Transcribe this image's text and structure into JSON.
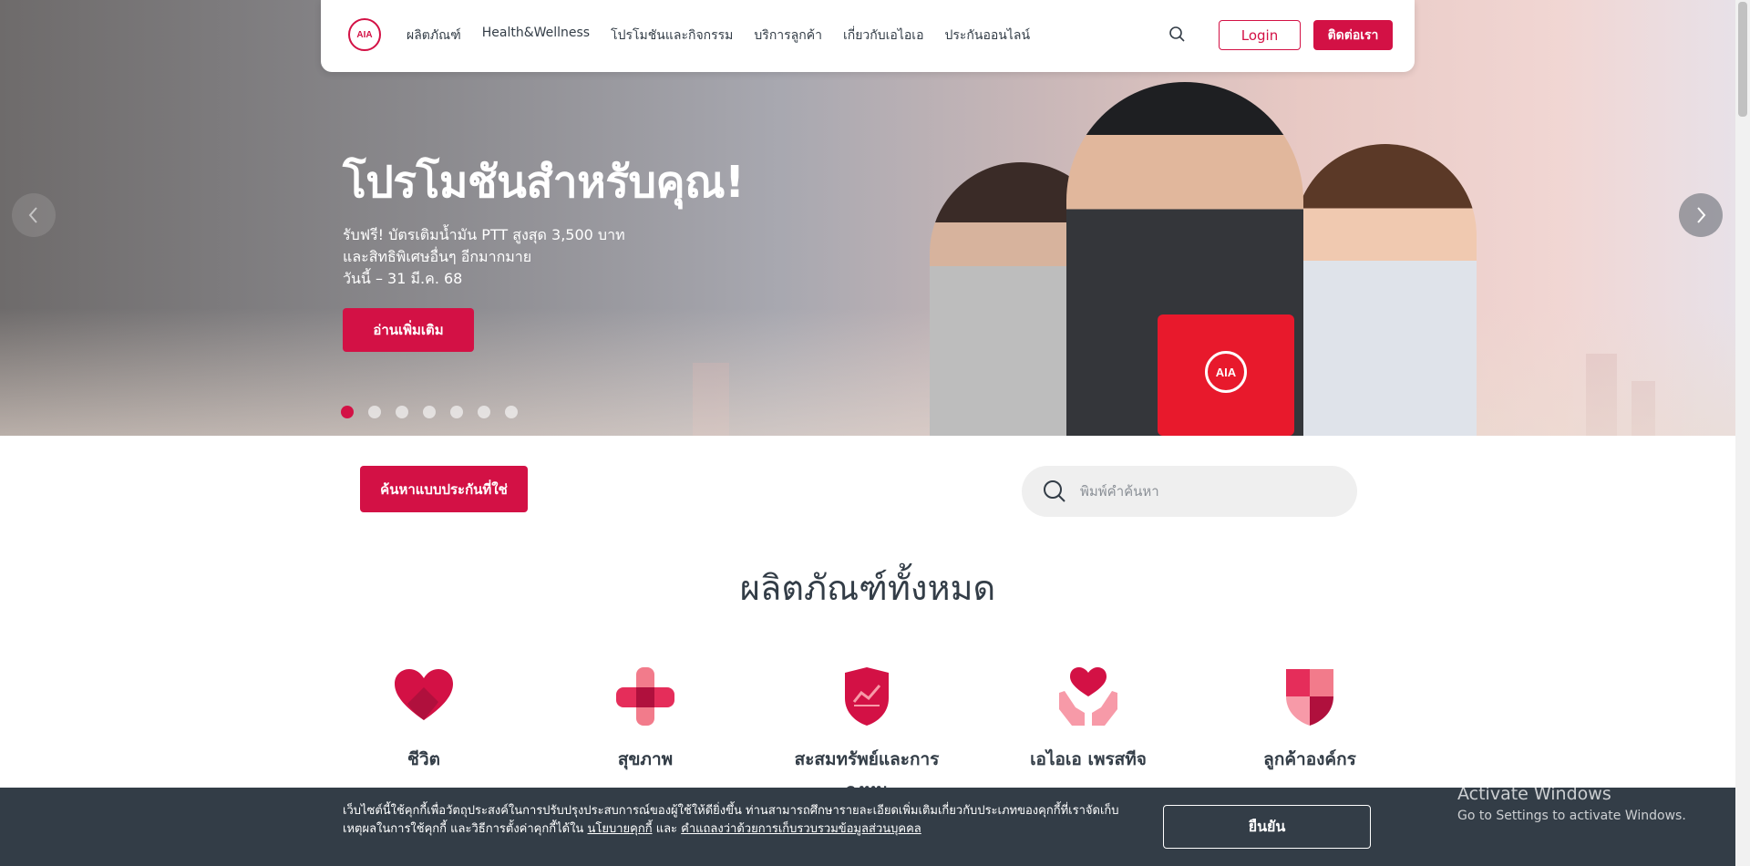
{
  "nav": {
    "logo_text": "AIA",
    "menu": [
      "ผลิตภัณฑ์",
      "Health&Wellness",
      "โปรโมชันและกิจกรรม",
      "บริการลูกค้า",
      "เกี่ยวกับเอไอเอ",
      "ประกันออนไลน์"
    ],
    "login_label": "Login",
    "contact_label": "ติดต่อเรา"
  },
  "hero": {
    "title": "โปรโมชันสำหรับคุณ!",
    "desc_lines": [
      "รับฟรี! บัตรเติมน้ำมัน PTT สูงสุด 3,500 บาท",
      "และสิทธิพิเศษอื่นๆ อีกมากมาย",
      "วันนี้ – 31 มี.ค. 68"
    ],
    "cta_label": "อ่านเพิ่มเติม",
    "slide_count": 7,
    "active_slide": 1,
    "folder_logo": "AIA"
  },
  "search": {
    "find_label": "ค้นหาแบบประกันที่ใช่",
    "placeholder": "พิมพ์คำค้นหา"
  },
  "products": {
    "title": "ผลิตภัณฑ์ทั้งหมด",
    "items": [
      {
        "label": "ชีวิต",
        "icon": "heart-icon"
      },
      {
        "label": "สุขภาพ",
        "icon": "health-cross-icon"
      },
      {
        "label": "สะสมทรัพย์และการลงทุน",
        "icon": "savings-shield-icon"
      },
      {
        "label": "เอไอเอ เพรสทีจ",
        "icon": "hands-heart-icon"
      },
      {
        "label": "ลูกค้าองค์กร",
        "icon": "corporate-shield-icon"
      }
    ]
  },
  "cookie": {
    "text": "เว็บไซต์นี้ใช้คุกกี้เพื่อวัตถุประสงค์ในการปรับปรุงประสบการณ์ของผู้ใช้ให้ดียิ่งขึ้น ท่านสามารถศึกษารายละเอียดเพิ่มเติมเกี่ยวกับประเภทของคุกกี้ที่เราจัดเก็บ เหตุผลในการใช้คุกกี้ และวิธีการตั้งค่าคุกกี้ได้ใน",
    "policy_link": "นโยบายคุกกี้",
    "and": "และ",
    "privacy_link": "คำแถลงว่าด้วยการเก็บรวบรวมข้อมูลส่วนบุคคล",
    "confirm_label": "ยืนยัน"
  },
  "watermark": {
    "line1": "Activate Windows",
    "line2": "Go to Settings to activate Windows."
  },
  "colors": {
    "brand": "#d31145",
    "dark": "#333d47"
  }
}
